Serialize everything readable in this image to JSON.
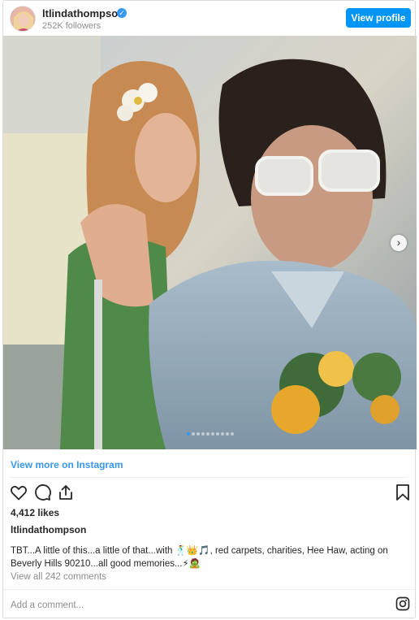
{
  "header": {
    "username": "ltlindathompson",
    "followers": "252K followers",
    "view_profile": "View profile"
  },
  "post": {
    "view_more": "View more on Instagram",
    "likes": "4,412 likes",
    "owner": "ltlindathompson",
    "caption": "TBT...A little of this...a little of that...with 🕺👑🎵, red carpets, charities, Hee Haw, acting on Beverly Hills 90210...all good memories...⚡🧟",
    "view_comments": "View all 242 comments",
    "add_comment_placeholder": "Add a comment...",
    "carousel_count": 10,
    "carousel_active": 1
  },
  "icons": {
    "like": "heart-icon",
    "comment": "comment-icon",
    "share": "share-icon",
    "save": "bookmark-icon",
    "instagram": "instagram-icon",
    "verified": "verified-icon",
    "next": "chevron-right-icon"
  },
  "colors": {
    "accent": "#0095f6",
    "link": "#3897f0",
    "muted": "#8e8e8e"
  }
}
